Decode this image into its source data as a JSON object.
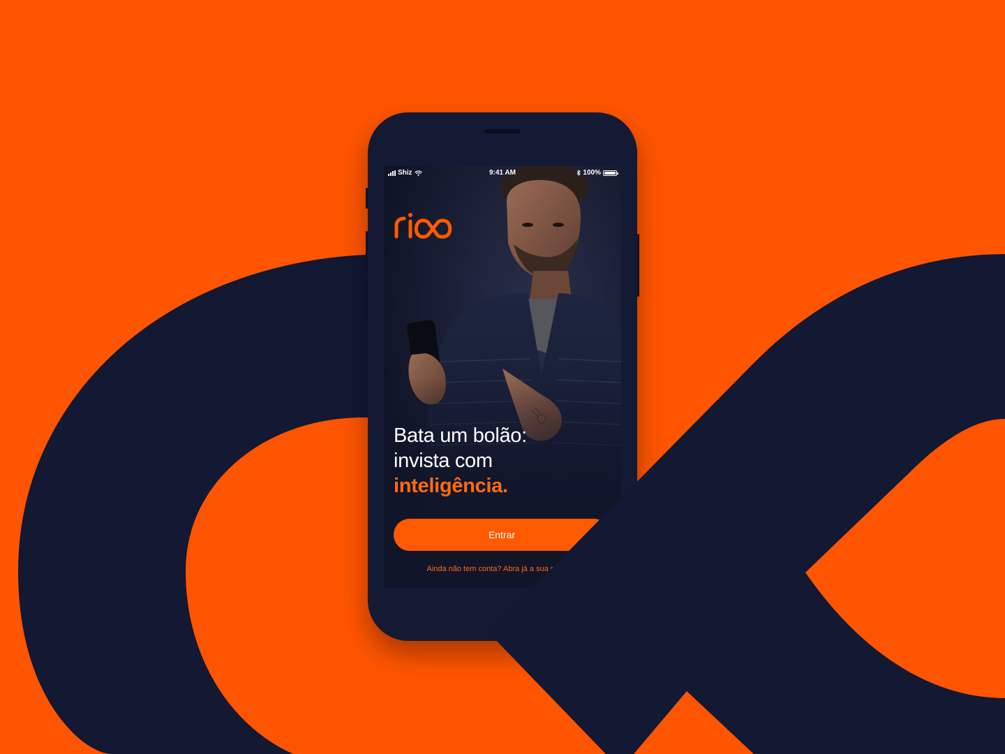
{
  "brand": {
    "logo_text": "rico",
    "accent_color": "#FF5500",
    "navy_color": "#131833"
  },
  "status_bar": {
    "carrier": "Shiz",
    "time": "9:41 AM",
    "battery": "100%",
    "battery_level": 1.0,
    "icons": [
      "signal-icon",
      "wifi-icon",
      "bluetooth-icon",
      "battery-icon"
    ]
  },
  "hero": {
    "line1": "Bata um bolão:",
    "line2": "invista com",
    "line3": "inteligência."
  },
  "actions": {
    "login_label": "Entrar",
    "signup_text": "Ainda não tem conta? Abra já a sua gratuita."
  }
}
